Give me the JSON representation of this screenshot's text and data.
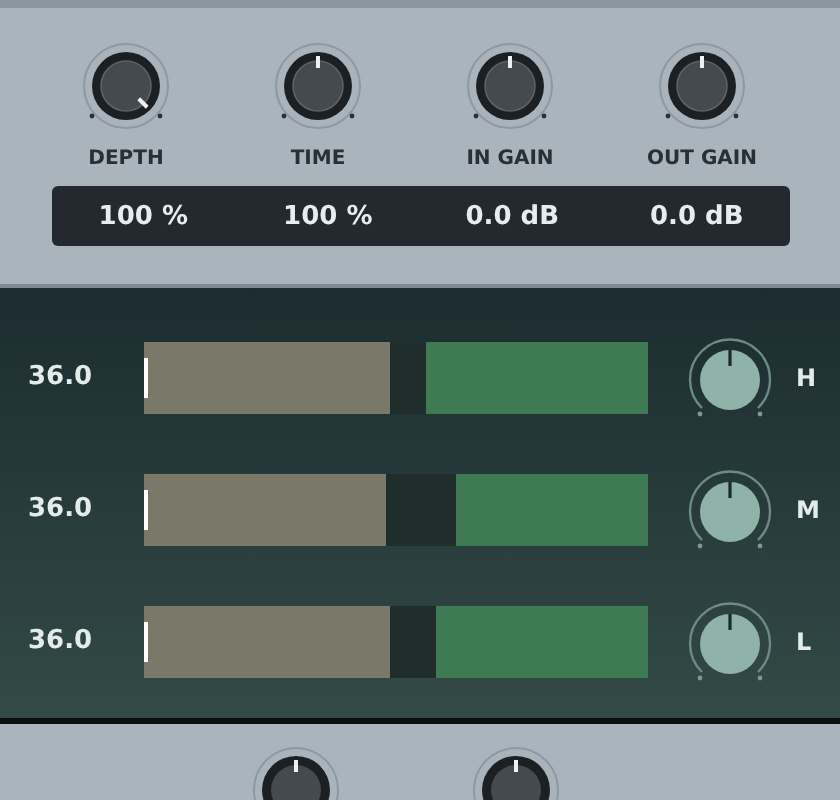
{
  "knobs": [
    {
      "label": "DEPTH",
      "at_max": true,
      "value": "100 %"
    },
    {
      "label": "TIME",
      "at_max": false,
      "value": "100 %"
    },
    {
      "label": "IN GAIN",
      "at_max": false,
      "value": "0.0 dB"
    },
    {
      "label": "OUT GAIN",
      "at_max": false,
      "value": "0.0 dB"
    }
  ],
  "bands": [
    {
      "reading": "36.0",
      "tan_meter": {
        "level": 0.49
      },
      "green_meter": {
        "level": 0.44
      },
      "knob": {
        "at_max": false
      },
      "label": "H"
    },
    {
      "reading": "36.0",
      "tan_meter": {
        "level": 0.48
      },
      "green_meter": {
        "level": 0.38
      },
      "knob": {
        "at_max": false
      },
      "label": "M"
    },
    {
      "reading": "36.0",
      "tan_meter": {
        "level": 0.49
      },
      "green_meter": {
        "level": 0.42
      },
      "knob": {
        "at_max": false
      },
      "label": "L"
    }
  ],
  "bottom_knobs": [
    {
      "at_max": false
    },
    {
      "at_max": false
    }
  ]
}
